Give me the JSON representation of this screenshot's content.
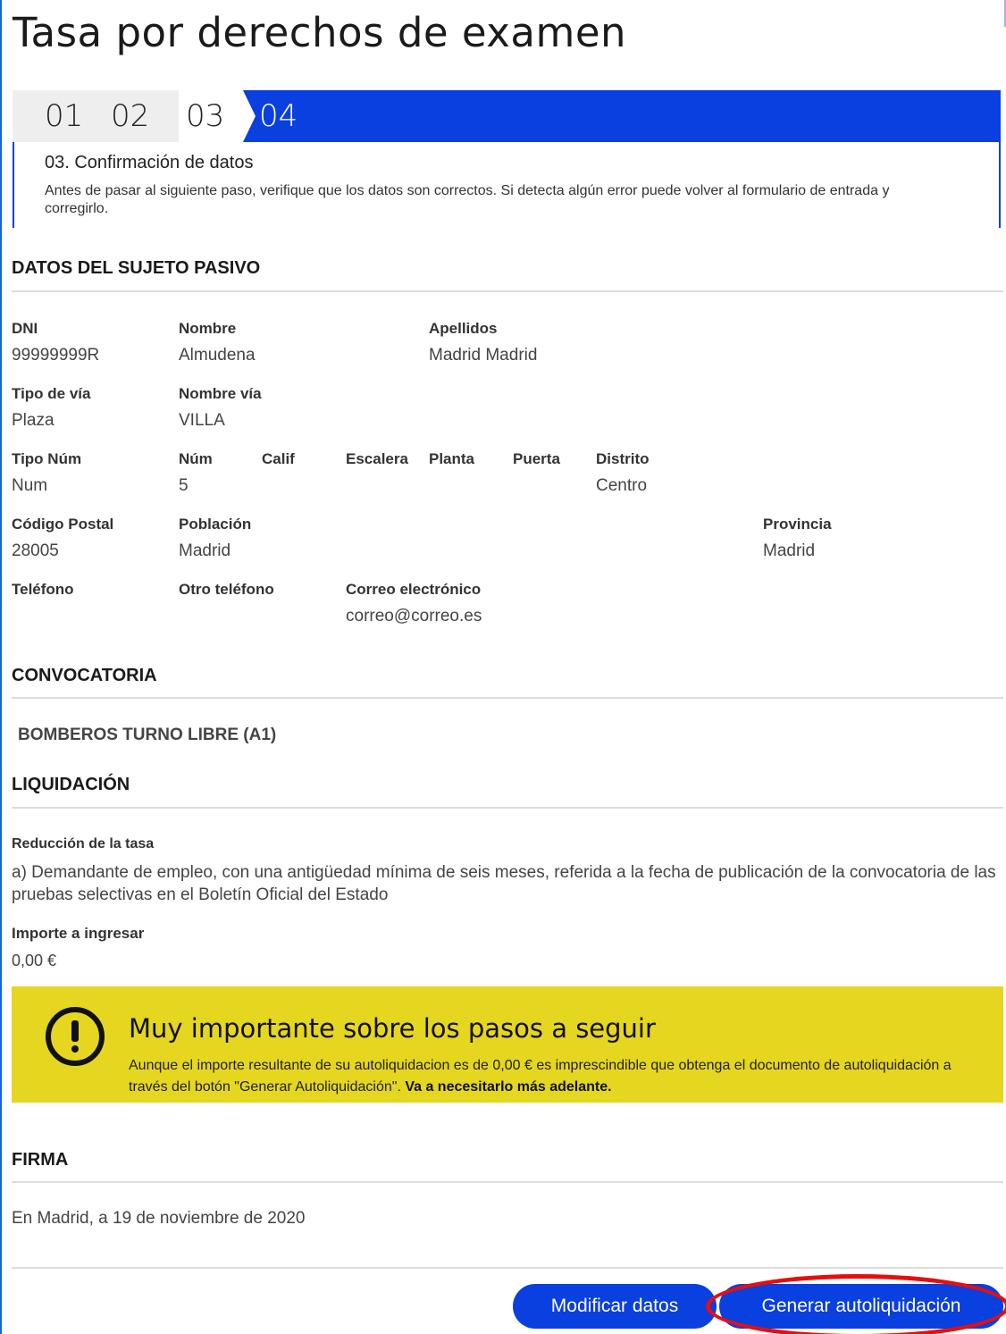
{
  "page": {
    "title": "Tasa por derechos de examen"
  },
  "steps": {
    "items": [
      "01",
      "02",
      "03",
      "04"
    ],
    "current_heading": "03. Confirmación de datos",
    "current_description": "Antes de pasar al siguiente paso, verifique que los datos son correctos. Si detecta algún error puede volver al formulario de entrada y corregirlo."
  },
  "sujeto": {
    "section_title": "DATOS DEL SUJETO PASIVO",
    "dni": {
      "label": "DNI",
      "value": "99999999R"
    },
    "nombre": {
      "label": "Nombre",
      "value": "Almudena"
    },
    "apellidos": {
      "label": "Apellidos",
      "value": "Madrid Madrid"
    },
    "tipo_via": {
      "label": "Tipo de vía",
      "value": "Plaza"
    },
    "nombre_via": {
      "label": "Nombre vía",
      "value": "VILLA"
    },
    "tipo_num": {
      "label": "Tipo Núm",
      "value": "Num"
    },
    "num": {
      "label": "Núm",
      "value": "5"
    },
    "calif": {
      "label": "Calif",
      "value": ""
    },
    "escalera": {
      "label": "Escalera",
      "value": ""
    },
    "planta": {
      "label": "Planta",
      "value": ""
    },
    "puerta": {
      "label": "Puerta",
      "value": ""
    },
    "distrito": {
      "label": "Distrito",
      "value": "Centro"
    },
    "codigo_postal": {
      "label": "Código Postal",
      "value": "28005"
    },
    "poblacion": {
      "label": "Población",
      "value": "Madrid"
    },
    "provincia": {
      "label": "Provincia",
      "value": "Madrid"
    },
    "telefono": {
      "label": "Teléfono",
      "value": ""
    },
    "otro_telefono": {
      "label": "Otro teléfono",
      "value": ""
    },
    "correo": {
      "label": "Correo electrónico",
      "value": "correo@correo.es"
    }
  },
  "convocatoria": {
    "section_title": "CONVOCATORIA",
    "value": "BOMBEROS TURNO LIBRE (A1)"
  },
  "liquidacion": {
    "section_title": "LIQUIDACIÓN",
    "reduccion_label": "Reducción de la tasa",
    "reduccion_value": "a) Demandante de empleo, con una antigüedad mínima de seis meses, referida a la fecha de publicación de la convocatoria de las pruebas selectivas en el Boletín Oficial del Estado",
    "importe_label": "Importe a ingresar",
    "importe_value": "0,00 €"
  },
  "notice": {
    "icon": "exclamation-circle-icon",
    "title": "Muy importante sobre los pasos a seguir",
    "text": "Aunque el importe resultante de su autoliquidacion es de 0,00 € es imprescindible que obtenga el documento de autoliquidación a través del botón \"Generar Autoliquidación\". ",
    "text_bold": "Va a necesitarlo más adelante.",
    "background": "#e5d61f"
  },
  "firma": {
    "section_title": "FIRMA",
    "text": "En Madrid, a 19 de noviembre de 2020"
  },
  "actions": {
    "modify_label": "Modificar datos",
    "generate_label": "Generar autoliquidación",
    "button_color": "#0a3fe0",
    "highlight_color": "#e50f0f"
  }
}
